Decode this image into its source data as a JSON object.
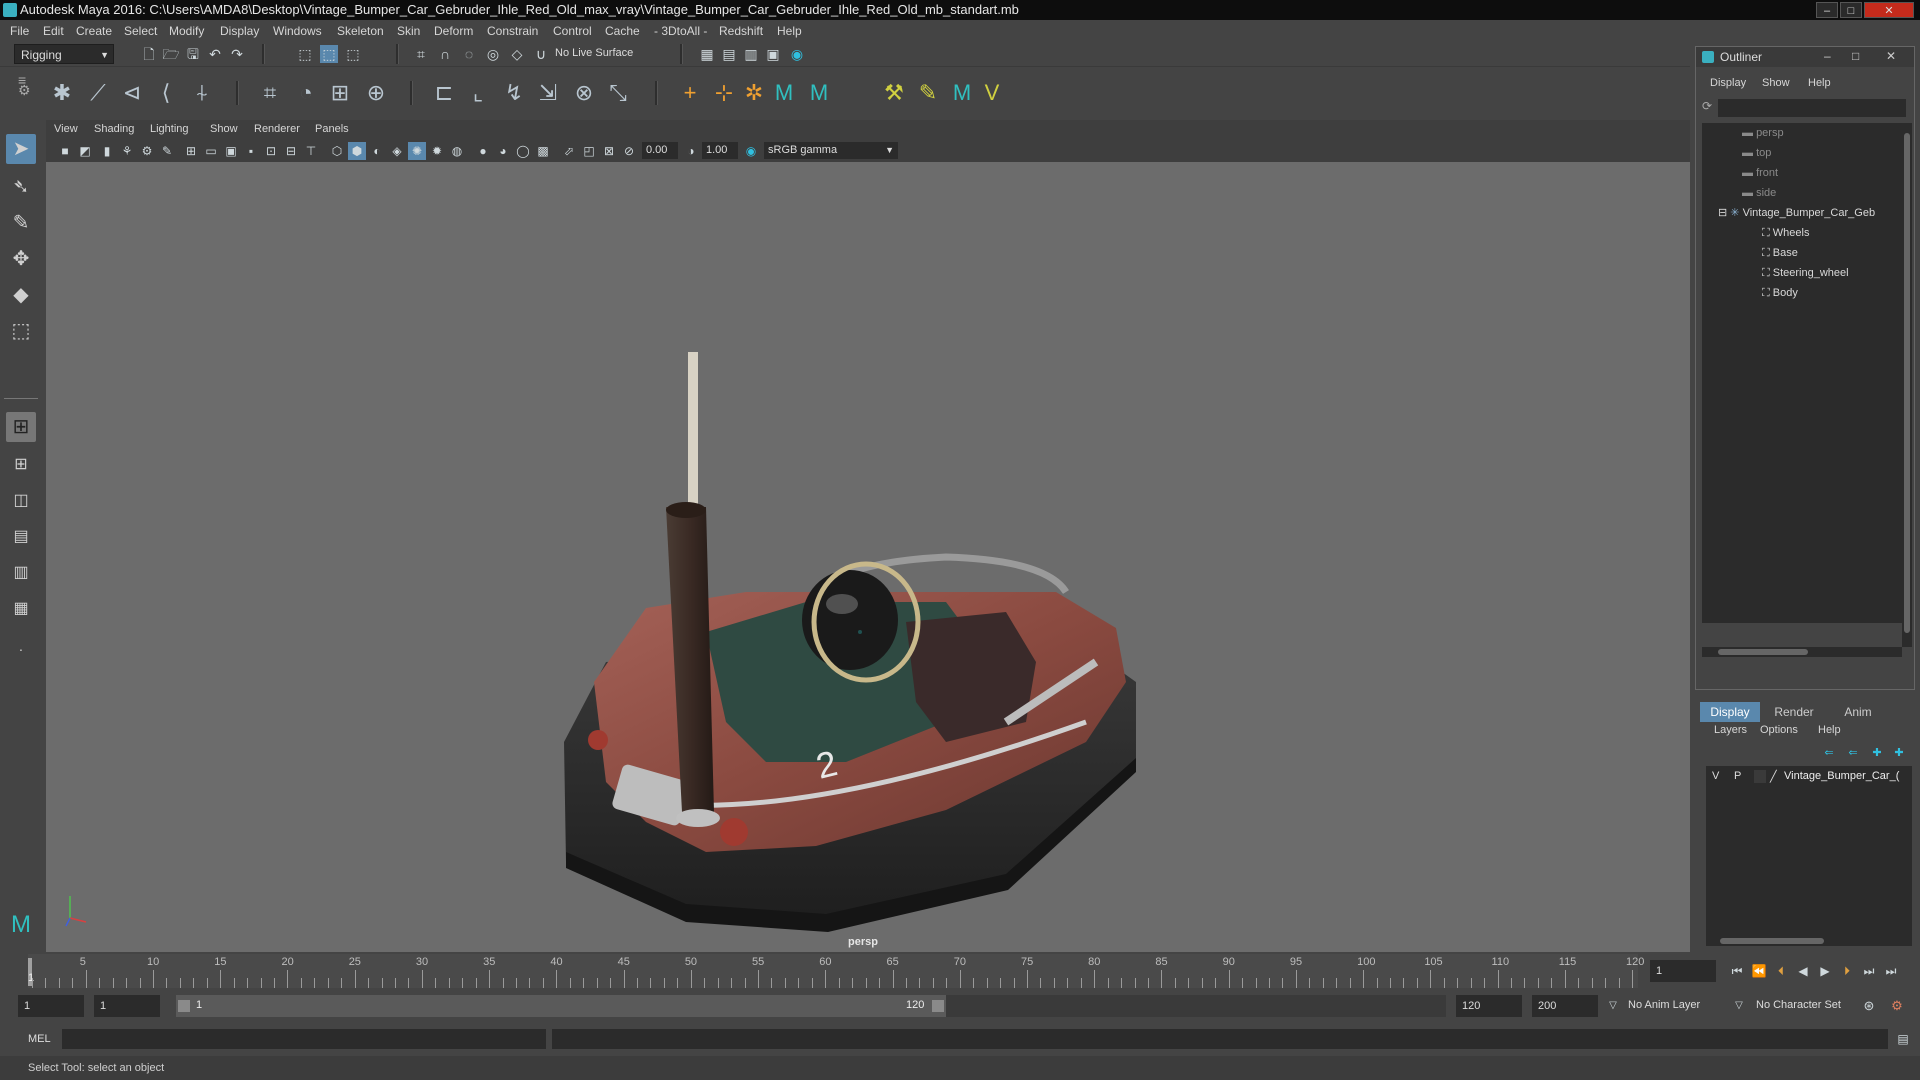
{
  "window": {
    "title": "Autodesk Maya 2016: C:\\Users\\AMDA8\\Desktop\\Vintage_Bumper_Car_Gebruder_Ihle_Red_Old_max_vray\\Vintage_Bumper_Car_Gebruder_Ihle_Red_Old_mb_standart.mb"
  },
  "menubar": [
    "File",
    "Edit",
    "Create",
    "Select",
    "Modify",
    "Display",
    "Windows",
    "Skeleton",
    "Skin",
    "Deform",
    "Constrain",
    "Control",
    "Cache",
    "- 3DtoAll -",
    "Redshift",
    "Help"
  ],
  "statusline": {
    "mode": "Rigging",
    "live_surface": "No Live Surface"
  },
  "viewport": {
    "menu": [
      "View",
      "Shading",
      "Lighting",
      "Show",
      "Renderer",
      "Panels"
    ],
    "exposure": "0.00",
    "gamma": "1.00",
    "color_space": "sRGB gamma",
    "camera_label": "persp",
    "car_number": "2"
  },
  "outliner": {
    "title": "Outliner",
    "menu": [
      "Display",
      "Show",
      "Help"
    ],
    "cameras": [
      "persp",
      "top",
      "front",
      "side"
    ],
    "root": "Vintage_Bumper_Car_Geb",
    "children": [
      "Wheels",
      "Base",
      "Steering_wheel",
      "Body"
    ]
  },
  "layer_panel": {
    "tabs": [
      "Display",
      "Render",
      "Anim"
    ],
    "menu": [
      "Layers",
      "Options",
      "Help"
    ],
    "layer": {
      "v": "V",
      "p": "P",
      "name": "Vintage_Bumper_Car_("
    }
  },
  "timeline": {
    "ticks": [
      "1",
      "5",
      "10",
      "15",
      "20",
      "25",
      "30",
      "35",
      "40",
      "45",
      "50",
      "55",
      "60",
      "65",
      "70",
      "75",
      "80",
      "85",
      "90",
      "95",
      "100",
      "105",
      "110",
      "115",
      "120"
    ],
    "current_frame": "1"
  },
  "range": {
    "start": "1",
    "anim_start": "1",
    "slider_start": "1",
    "slider_end": "120",
    "end": "120",
    "anim_end": "200",
    "anim_layer": "No Anim Layer",
    "character_set": "No Character Set"
  },
  "command": {
    "language": "MEL"
  },
  "help": {
    "text": "Select Tool: select an object"
  }
}
